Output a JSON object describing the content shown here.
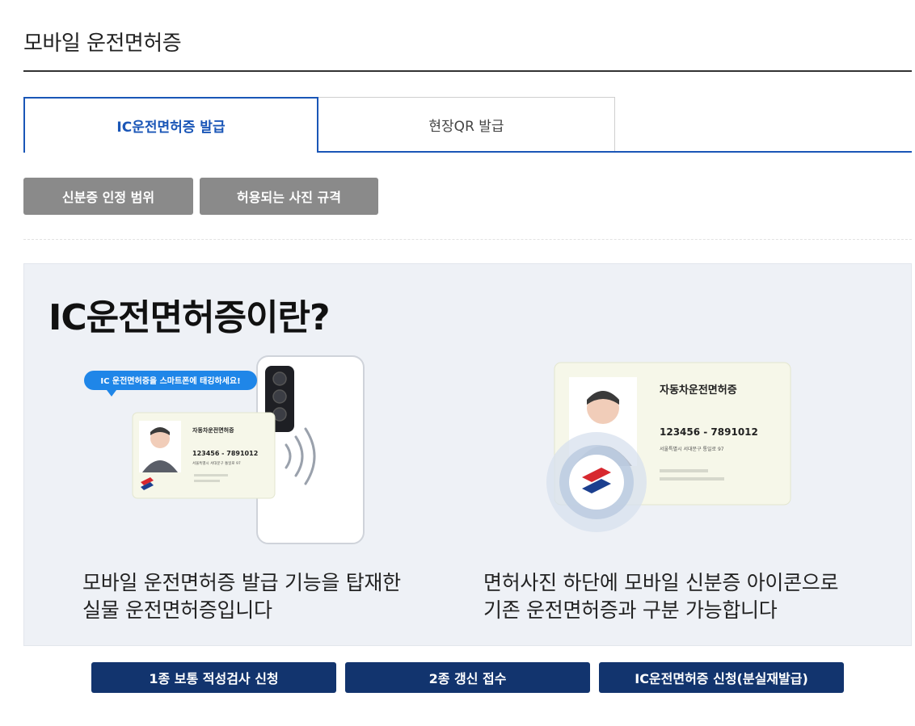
{
  "header": {
    "title": "모바일 운전면허증"
  },
  "tabs": [
    {
      "label": "IC운전면허증 발급",
      "active": true
    },
    {
      "label": "현장QR 발급",
      "active": false
    }
  ],
  "info_buttons": [
    {
      "label": "신분증 인정 범위"
    },
    {
      "label": "허용되는 사진 규격"
    }
  ],
  "panel": {
    "heading": "IC운전면허증이란?",
    "left": {
      "bubble": "IC 운전면허증을 스마트폰에 태깅하세요!",
      "card_title": "자동차운전면허증",
      "card_number": "123456 - 7891012",
      "card_address": "서울특별시 서대문구 통일로 97",
      "description_line1": "모바일 운전면허증 발급 기능을 탑재한",
      "description_line2": "실물 운전면허증입니다"
    },
    "right": {
      "card_title": "자동차운전면허증",
      "card_number": "123456 - 7891012",
      "card_address": "서울특별시 서대문구 통일로 97",
      "description_line1": "면허사진 하단에 모바일 신분증 아이콘으로",
      "description_line2": "기존 운전면허증과 구분 가능합니다"
    }
  },
  "action_buttons": [
    {
      "label": "1종 보통 적성검사 신청"
    },
    {
      "label": "2종 갱신 접수"
    },
    {
      "label": "IC운전면허증 신청(분실재발급)"
    }
  ],
  "colors": {
    "accent": "#1a56b7",
    "navy": "#12346e",
    "gray_button": "#8a8a8a",
    "panel_bg": "#eef1f6"
  }
}
